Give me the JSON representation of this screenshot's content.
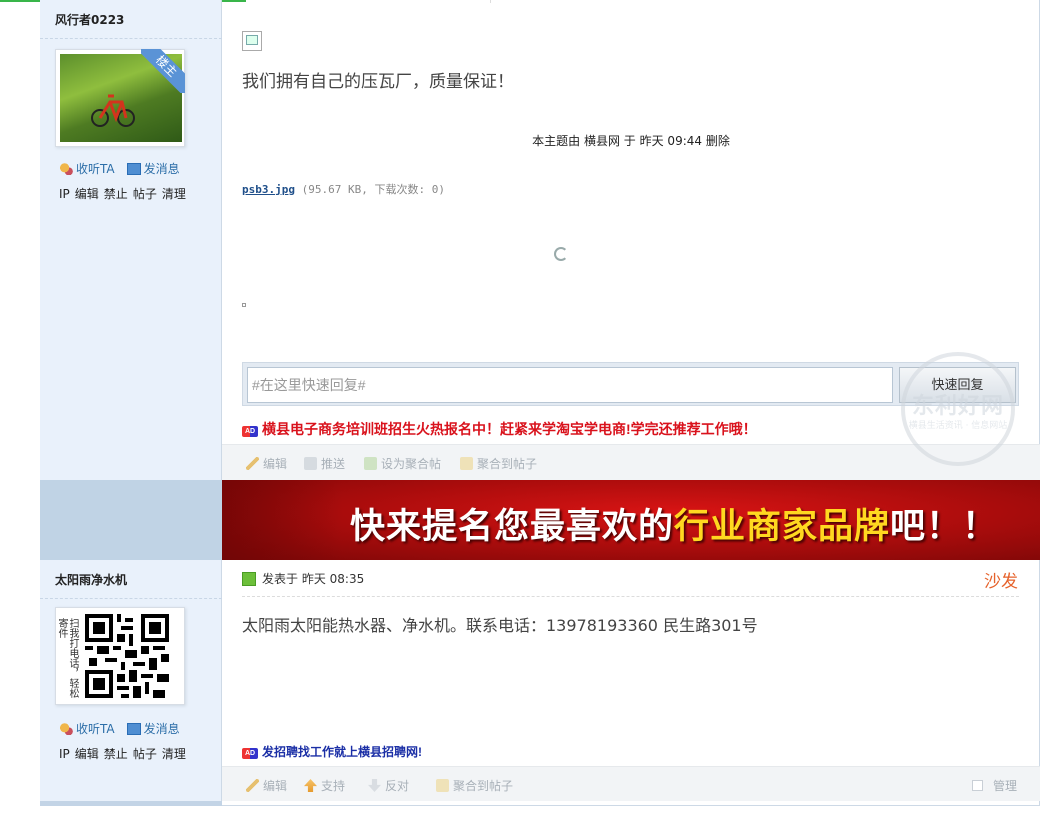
{
  "post1": {
    "author": "风行者0223",
    "badge": "楼主",
    "listen_label": "收听TA",
    "message_label": "发消息",
    "admin_links": [
      "IP",
      "编辑",
      "禁止",
      "帖子",
      "清理"
    ],
    "message": "我们拥有自己的压瓦厂，质量保证！",
    "edited_note": "本主题由  横县网  于  昨天   09:44  删除",
    "attachment_name": "psb3.jpg",
    "attachment_meta": "(95.67 KB, 下载次数: 0)",
    "quick_reply_placeholder": "#在这里快速回复#",
    "quick_reply_button": "快速回复",
    "ad_text": "横县电子商务培训班招生火热报名中！赶紧来学淘宝学电商!学完还推荐工作哦！",
    "tools": [
      "编辑",
      "推送",
      "设为聚合帖",
      "聚合到帖子"
    ]
  },
  "banner": {
    "text_before": "快来提名您最喜欢的",
    "text_highlight": "行业商家品牌",
    "text_after": "吧！！"
  },
  "post2": {
    "author": "太阳雨净水机",
    "qr_caption": "扫我打电话，轻松寄件",
    "listen_label": "收听TA",
    "message_label": "发消息",
    "admin_links": [
      "IP",
      "编辑",
      "禁止",
      "帖子",
      "清理"
    ],
    "posted_at": "发表于  昨天   08:35",
    "floor": "沙发",
    "message": "太阳雨太阳能热水器、净水机。联系电话：13978193360 民生路301号",
    "ad_text": "发招聘找工作就上横县招聘网!",
    "tools": [
      "编辑",
      "支持",
      "反对",
      "聚合到帖子"
    ],
    "manage_label": "管理"
  },
  "watermark": {
    "title": "东利好网",
    "subtitle": "横县生活资讯 · 信息网站"
  }
}
